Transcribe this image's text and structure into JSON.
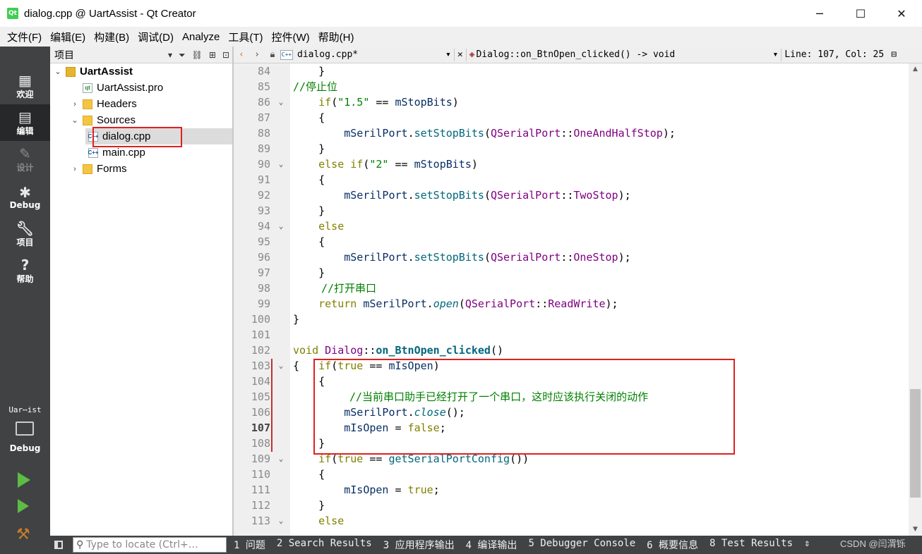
{
  "window": {
    "title": "dialog.cpp @ UartAssist - Qt Creator",
    "app_icon": "Qt",
    "minimize": "─",
    "maximize": "☐",
    "close": "✕"
  },
  "menu": [
    "文件(F)",
    "编辑(E)",
    "构建(B)",
    "调试(D)",
    "Analyze",
    "工具(T)",
    "控件(W)",
    "帮助(H)"
  ],
  "modes": [
    {
      "label": "欢迎",
      "icon": "grid-icon"
    },
    {
      "label": "编辑",
      "icon": "document-icon"
    },
    {
      "label": "设计",
      "icon": "pencil-icon"
    },
    {
      "label": "Debug",
      "icon": "bug-icon"
    },
    {
      "label": "项目",
      "icon": "wrench-icon"
    },
    {
      "label": "帮助",
      "icon": "help-icon"
    }
  ],
  "kit": {
    "project": "Uar⋯ist",
    "config": "Debug"
  },
  "project_pane": {
    "title": "项目",
    "tree": [
      {
        "label": "UartAssist",
        "depth": 0,
        "expanded": true,
        "bold": true,
        "icon": "project-icon"
      },
      {
        "label": "UartAssist.pro",
        "depth": 1,
        "icon": "pro-file-icon"
      },
      {
        "label": "Headers",
        "depth": 1,
        "expanded": false,
        "icon": "headers-folder-icon"
      },
      {
        "label": "Sources",
        "depth": 1,
        "expanded": true,
        "icon": "sources-folder-icon"
      },
      {
        "label": "dialog.cpp",
        "depth": 2,
        "selected": true,
        "icon": "cpp-file-icon"
      },
      {
        "label": "main.cpp",
        "depth": 2,
        "icon": "cpp-file-icon"
      },
      {
        "label": "Forms",
        "depth": 1,
        "expanded": false,
        "icon": "forms-folder-icon"
      }
    ]
  },
  "editor": {
    "file": "dialog.cpp*",
    "symbol": "Dialog::on_BtnOpen_clicked() -> void",
    "position": "Line: 107, Col: 25",
    "current_line": 107,
    "highlight_color": "#e02020"
  },
  "code_lines": [
    {
      "n": 84,
      "fold": false
    },
    {
      "n": 85,
      "fold": false
    },
    {
      "n": 86,
      "fold": true
    },
    {
      "n": 87,
      "fold": false
    },
    {
      "n": 88,
      "fold": false
    },
    {
      "n": 89,
      "fold": false
    },
    {
      "n": 90,
      "fold": true
    },
    {
      "n": 91,
      "fold": false
    },
    {
      "n": 92,
      "fold": false
    },
    {
      "n": 93,
      "fold": false
    },
    {
      "n": 94,
      "fold": true
    },
    {
      "n": 95,
      "fold": false
    },
    {
      "n": 96,
      "fold": false
    },
    {
      "n": 97,
      "fold": false
    },
    {
      "n": 98,
      "fold": false
    },
    {
      "n": 99,
      "fold": false
    },
    {
      "n": 100,
      "fold": false
    },
    {
      "n": 101,
      "fold": false
    },
    {
      "n": 102,
      "fold": false
    },
    {
      "n": 103,
      "fold": true
    },
    {
      "n": 104,
      "fold": false
    },
    {
      "n": 105,
      "fold": false
    },
    {
      "n": 106,
      "fold": false
    },
    {
      "n": 107,
      "fold": false
    },
    {
      "n": 108,
      "fold": false
    },
    {
      "n": 109,
      "fold": true
    },
    {
      "n": 110,
      "fold": false
    },
    {
      "n": 111,
      "fold": false
    },
    {
      "n": 112,
      "fold": false
    },
    {
      "n": 113,
      "fold": true
    }
  ],
  "code": {
    "comment_stopbits": "//停止位",
    "comment_open": "//打开串口",
    "comment_close": "//当前串口助手已经打开了一个串口，这时应该执行关闭的动作",
    "str_15": "\"1.5\"",
    "str_2": "\"2\"",
    "stop_onehalf": "OneAndHalfStop",
    "stop_two": "TwoStop",
    "stop_one": "OneStop",
    "readwrite": "ReadWrite"
  },
  "statusbar": {
    "locator_placeholder": "Type to locate (Ctrl+…",
    "panes": [
      "1 问题",
      "2 Search Results",
      "3 应用程序输出",
      "4 编译输出",
      "5 Debugger Console",
      "6 概要信息",
      "8 Test Results"
    ],
    "more": "⇕"
  },
  "watermark": "CSDN @闫渭铄"
}
